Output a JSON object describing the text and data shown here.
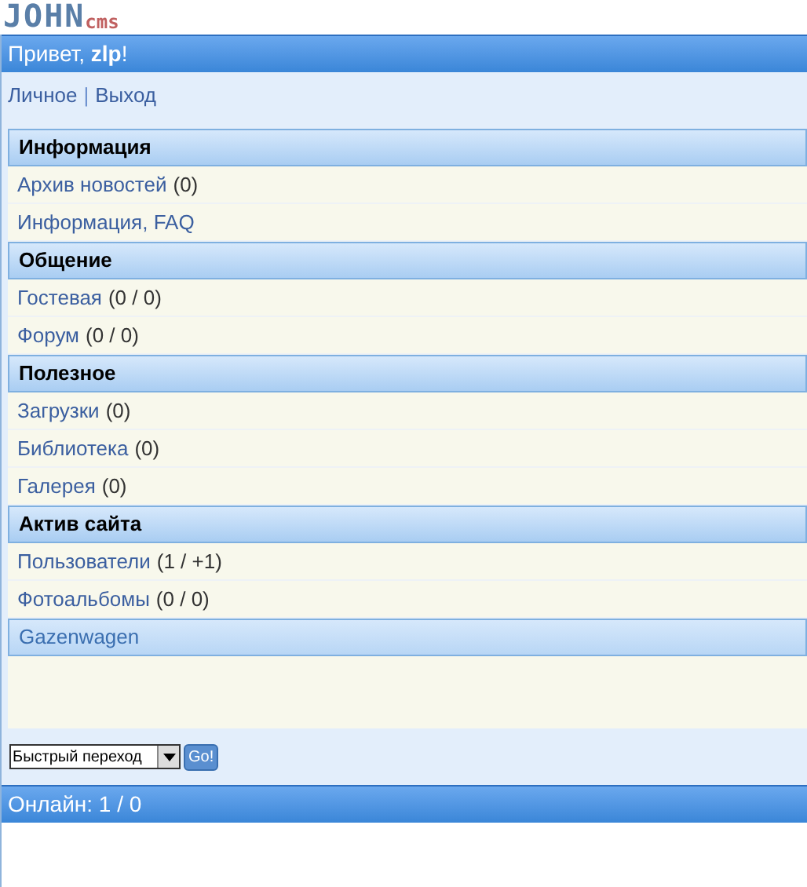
{
  "logo": {
    "main": "JOHN",
    "sub": "cms"
  },
  "greeting": {
    "prefix": "Привет, ",
    "user": "zlp",
    "suffix": "!"
  },
  "user_links": [
    {
      "label": "Личное"
    },
    {
      "label": "Выход"
    }
  ],
  "user_links_separator": "|",
  "sections": [
    {
      "title": "Информация",
      "items": [
        {
          "label": "Архив новостей",
          "count": "(0)"
        },
        {
          "label": "Информация, FAQ"
        }
      ]
    },
    {
      "title": "Общение",
      "items": [
        {
          "label": "Гостевая",
          "count": "(0 / 0)"
        },
        {
          "label": "Форум",
          "count": "(0 / 0)"
        }
      ]
    },
    {
      "title": "Полезное",
      "items": [
        {
          "label": "Загрузки",
          "count": "(0)"
        },
        {
          "label": "Библиотека",
          "count": "(0)"
        },
        {
          "label": "Галерея",
          "count": "(0)"
        }
      ]
    },
    {
      "title": "Актив сайта",
      "items": [
        {
          "label": "Пользователи",
          "count": "(1 / +1)"
        },
        {
          "label": "Фотоальбомы",
          "count": "(0 / 0)"
        }
      ]
    }
  ],
  "ad_bar": {
    "text": "Gazenwagen"
  },
  "quick_nav": {
    "value": "Быстрый переход",
    "button": "Go!"
  },
  "footer": {
    "text": "Онлайн: 1 / 0"
  }
}
